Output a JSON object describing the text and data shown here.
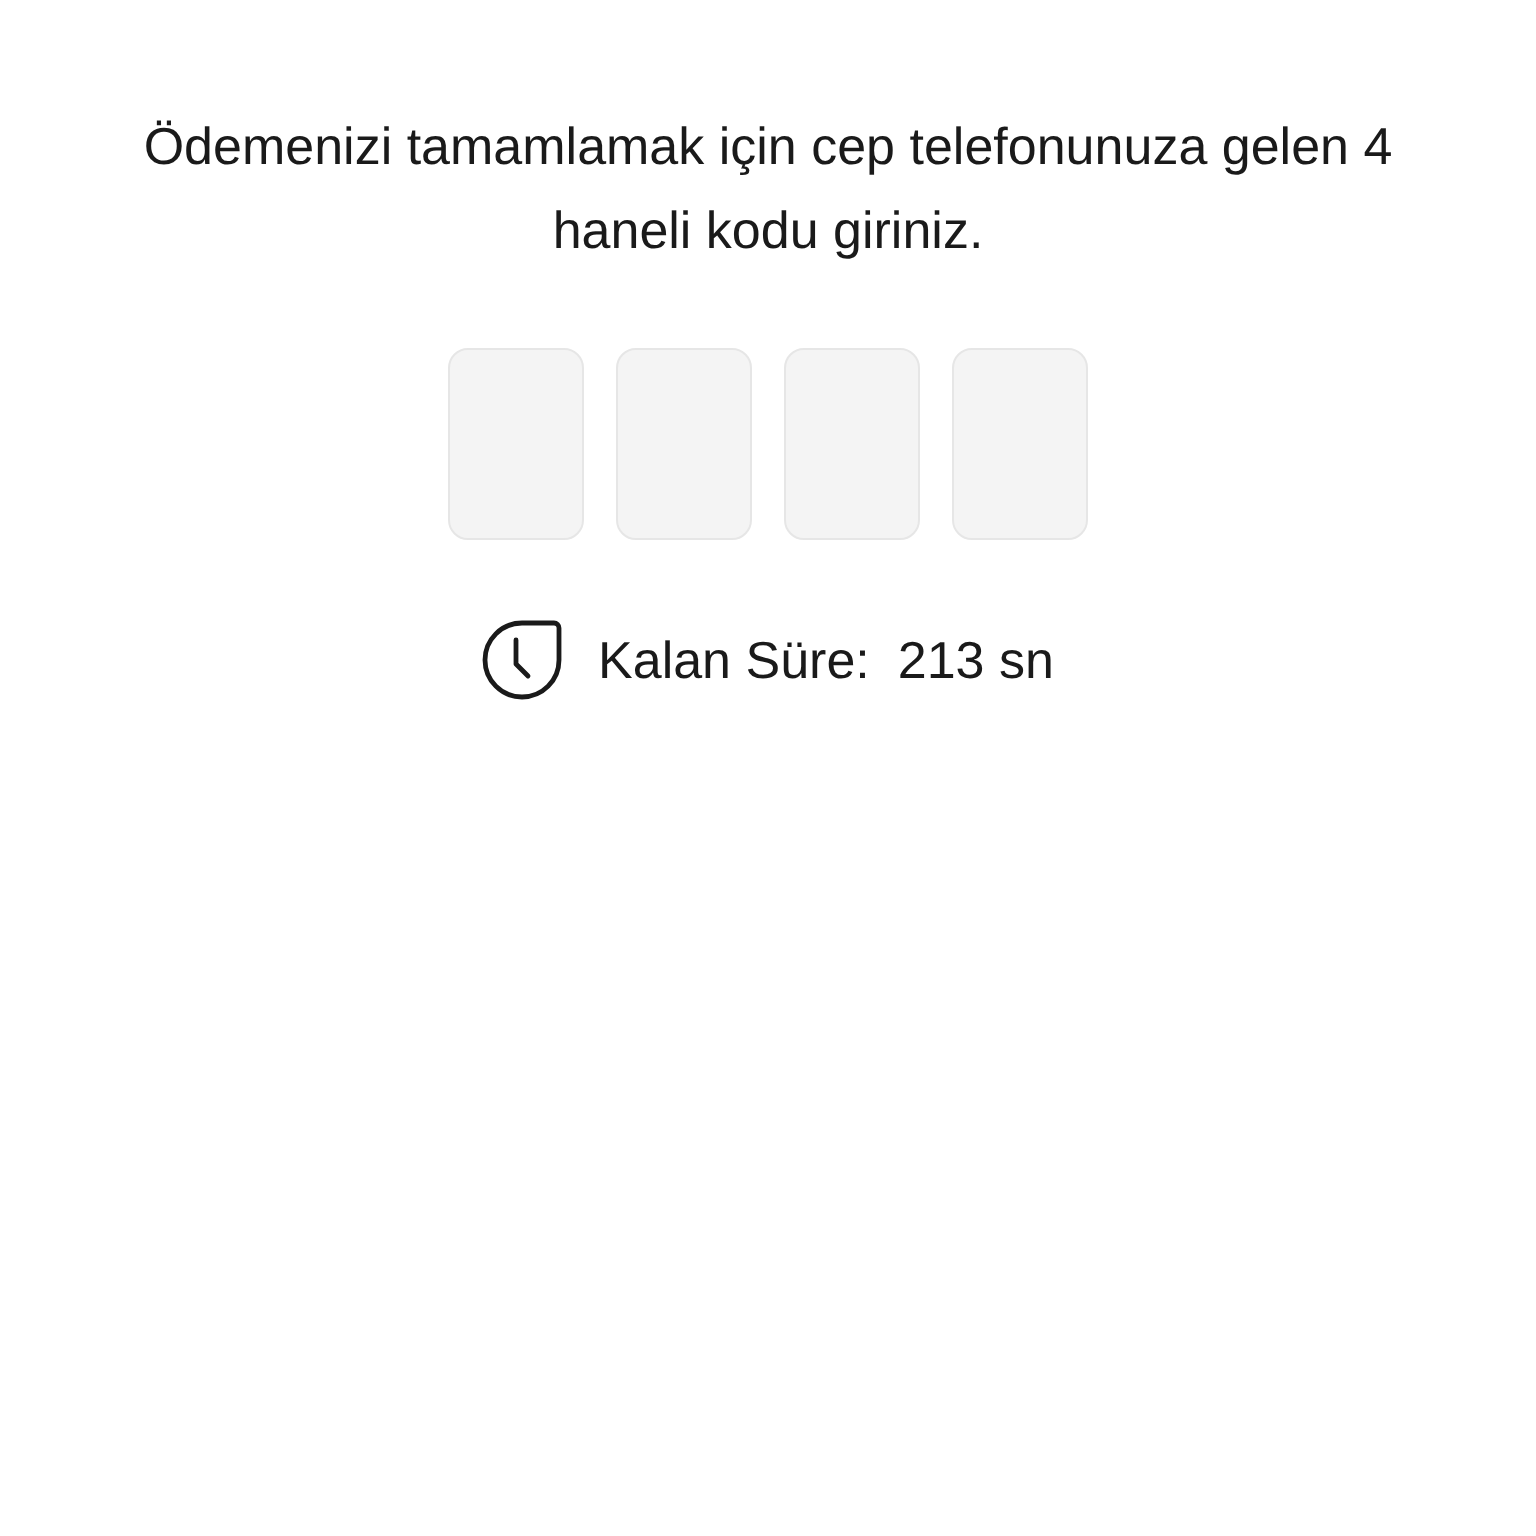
{
  "instruction": "Ödemenizi tamamlamak için cep telefonunuza gelen 4 haneli kodu giriniz.",
  "code_fields": [
    {
      "focused": false
    },
    {
      "focused": false
    },
    {
      "focused": false
    },
    {
      "focused": false
    }
  ],
  "timer": {
    "label": "Kalan Süre:",
    "value": "213 sn"
  }
}
